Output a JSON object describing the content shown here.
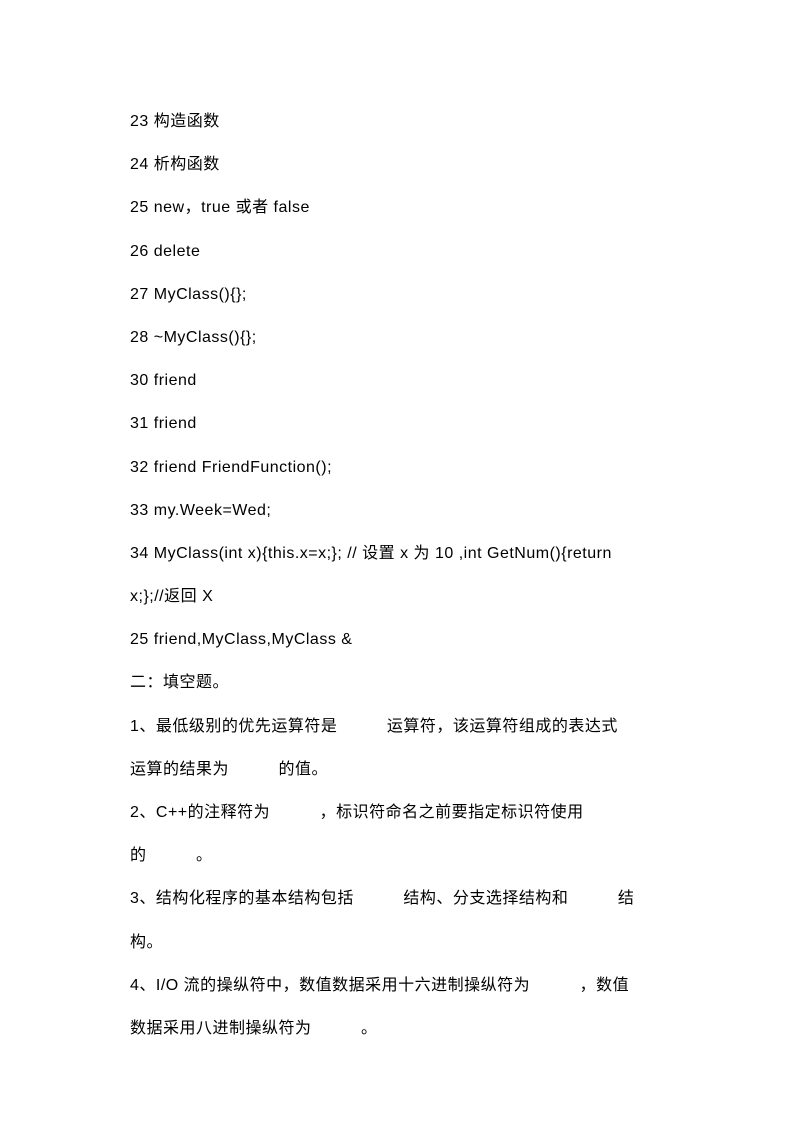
{
  "lines": {
    "l1": "23  构造函数",
    "l2": "24  析构函数",
    "l3": "25 new，true 或者 false",
    "l4": "26 delete",
    "l5": "27 MyClass(){};",
    "l6": "28 ~MyClass(){};",
    "l7": "30 friend",
    "l8": "31 friend",
    "l9": "32 friend FriendFunction();",
    "l10": "33 my.Week=Wed;",
    "l11": "34 MyClass(int x){this.x=x;}; //  设置 x 为 10   ,int GetNum(){return",
    "l12": "x;};//返回 X",
    "l13": "25 friend,MyClass,MyClass &",
    "l14": "二：填空题。",
    "l15": "1、最低级别的优先运算符是   运算符，该运算符组成的表达式",
    "l16": "运算的结果为   的值。",
    "l17": "2、C++的注释符为   ，标识符命名之前要指定标识符使用",
    "l18": "的   。",
    "l19": "3、结构化程序的基本结构包括   结构、分支选择结构和   结",
    "l20": "构。",
    "l21": "4、I/O 流的操纵符中，数值数据采用十六进制操纵符为   ，数值",
    "l22": "数据采用八进制操纵符为   。"
  }
}
